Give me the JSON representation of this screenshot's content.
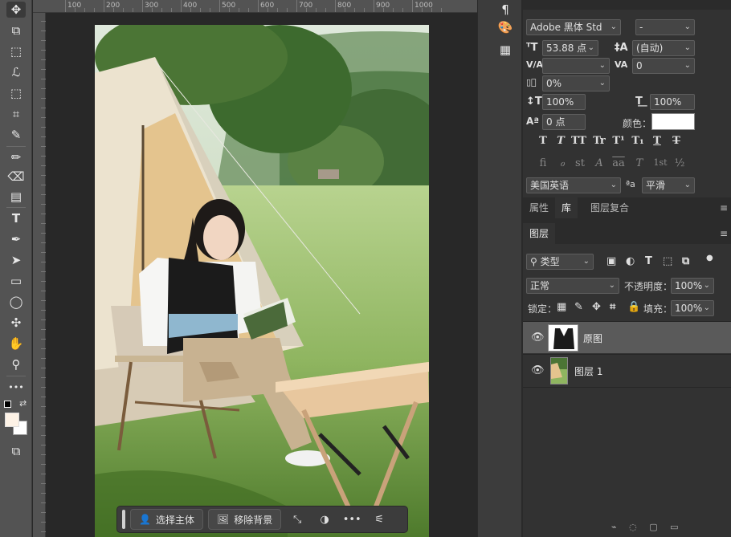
{
  "tools": {
    "move": "✥",
    "artboard": "⧉",
    "marquee": "⬚",
    "lasso": "ℒ",
    "object_select": "⬚",
    "crop": "⌗",
    "eyedropper": "✎",
    "brush": "✏",
    "eraser": "⌫",
    "gradient": "▤",
    "type": "T",
    "pen": "✒",
    "path_select": "➤",
    "rectangle": "▭",
    "ellipse": "◯",
    "puzzle": "✣",
    "hand": "✋",
    "zoom": "⚲",
    "more": "•••",
    "screen_mode": "⧉"
  },
  "ruler_labels": [
    "100",
    "200",
    "300",
    "400",
    "500",
    "600",
    "700",
    "800",
    "900",
    "1000"
  ],
  "taskbar": {
    "select_subject": "选择主体",
    "remove_background": "移除背景",
    "more": "•••"
  },
  "character_panel": {
    "font_family": "Adobe 黑体 Std",
    "font_style": "-",
    "font_size": "53.88 点",
    "leading": "(自动)",
    "kerning": "",
    "tracking": "0",
    "scale_proportion": "0%",
    "vertical_scale": "100%",
    "horizontal_scale": "100%",
    "baseline_shift": "0 点",
    "color_label": "颜色：",
    "language": "美国英语",
    "aa_label": "ªa",
    "antialias": "平滑",
    "format_buttons": [
      "T",
      "T",
      "TT",
      "Tr",
      "T¹",
      "T₁",
      "T",
      "T"
    ],
    "opentype_buttons": [
      "fi",
      "ℴ",
      "st",
      "A",
      "aa",
      "T",
      "1st",
      "½"
    ]
  },
  "tabs_top": [
    "属性",
    "库",
    "图层复合"
  ],
  "tabs_layers": [
    "图层"
  ],
  "layers_panel": {
    "filter_kind": "类型",
    "blend_mode": "正常",
    "opacity_label": "不透明度：",
    "opacity": "100%",
    "lock_label": "锁定：",
    "fill_label": "填充：",
    "fill": "100%",
    "layers": [
      {
        "name": "原图",
        "selected": true
      },
      {
        "name": "图层 1",
        "selected": false
      }
    ]
  },
  "colors": {
    "foreground": "#fdf2e6",
    "background": "#ffffff",
    "text_color_swatch": "#ffffff"
  }
}
